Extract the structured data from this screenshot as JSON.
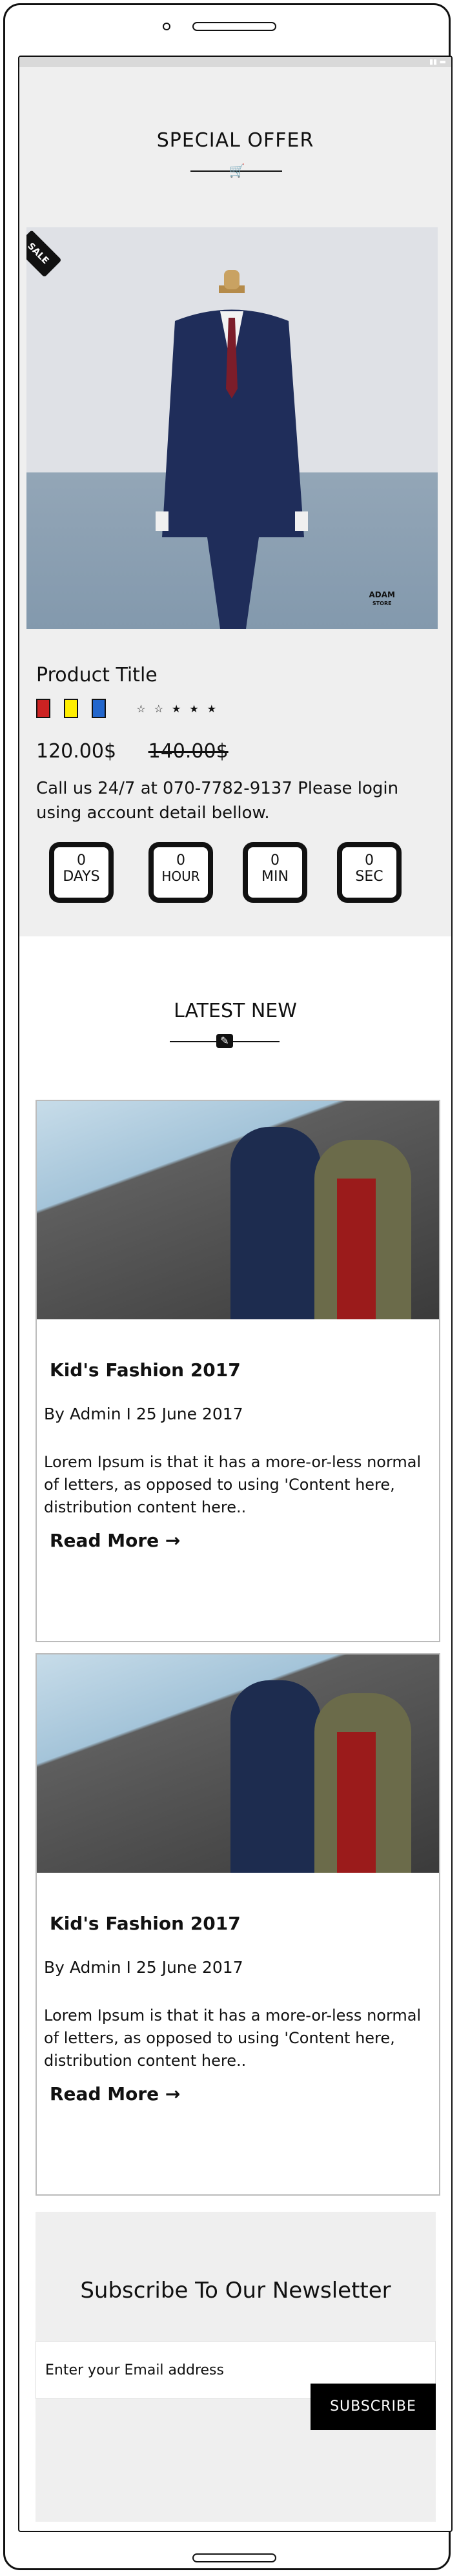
{
  "offer": {
    "title": "SPECIAL OFFER",
    "divider_icon": "cart-icon",
    "sale_badge": "SALE",
    "brand": "ADAM",
    "brand_sub": "STORE",
    "product_title": "Product Title",
    "swatch_colors": [
      "#cc2222",
      "#ffee00",
      "#2266cc"
    ],
    "rating": 3,
    "rating_max": 5,
    "price": "120.00$",
    "old_price": "140.00$",
    "call_text": "Call us 24/7 at 070-7782-9137 Please login using account detail bellow.",
    "timer": [
      {
        "value": "0",
        "label": "DAYS"
      },
      {
        "value": "0",
        "label": "HOUR"
      },
      {
        "value": "0",
        "label": "MIN"
      },
      {
        "value": "0",
        "label": "SEC"
      }
    ]
  },
  "latest": {
    "title": "LATEST NEW",
    "divider_icon": "pen-icon",
    "posts": [
      {
        "title": "Kid's Fashion 2017",
        "meta": "By Admin I 25 June 2017",
        "text": "Lorem Ipsum is that it has a more-or-less normal of letters, as opposed to using 'Content here, distribution content here..",
        "read_more": "Read More →"
      },
      {
        "title": "Kid's Fashion 2017",
        "meta": "By Admin I 25 June 2017",
        "text": "Lorem Ipsum is that it has a more-or-less normal of letters, as opposed to using 'Content here, distribution content here..",
        "read_more": "Read More →"
      }
    ]
  },
  "newsletter": {
    "title": "Subscribe To Our Newsletter",
    "placeholder": "Enter your Email address",
    "button": "SUBSCRIBE"
  }
}
